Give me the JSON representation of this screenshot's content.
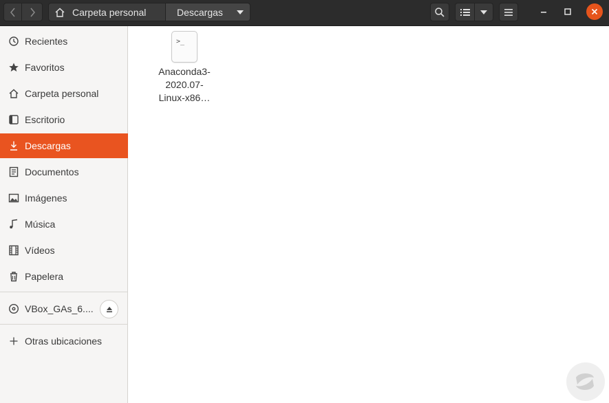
{
  "header": {
    "breadcrumbs": [
      {
        "label": "Carpeta personal",
        "icon": "home-icon"
      },
      {
        "label": "Descargas",
        "icon": "chevron-down-icon"
      }
    ],
    "buttons": {
      "back": "chevron-left-icon",
      "forward": "chevron-right-icon",
      "search": "search-icon",
      "view": "list-view-icon",
      "view_options": "chevron-down-icon",
      "menu": "hamburger-menu-icon",
      "minimize": "minimize-icon",
      "maximize": "maximize-icon",
      "close": "close-icon"
    }
  },
  "sidebar": {
    "items": [
      {
        "label": "Recientes",
        "icon": "clock-icon"
      },
      {
        "label": "Favoritos",
        "icon": "star-icon"
      },
      {
        "label": "Carpeta personal",
        "icon": "home-icon"
      },
      {
        "label": "Escritorio",
        "icon": "desktop-icon"
      },
      {
        "label": "Descargas",
        "icon": "download-icon",
        "active": true
      },
      {
        "label": "Documentos",
        "icon": "document-icon"
      },
      {
        "label": "Imágenes",
        "icon": "image-icon"
      },
      {
        "label": "Música",
        "icon": "music-icon"
      },
      {
        "label": "Vídeos",
        "icon": "video-icon"
      },
      {
        "label": "Papelera",
        "icon": "trash-icon"
      }
    ],
    "devices": [
      {
        "label": "VBox_GAs_6....",
        "icon": "disc-icon",
        "action": "eject-icon"
      }
    ],
    "other": {
      "label": "Otras ubicaciones",
      "icon": "plus-icon"
    }
  },
  "main": {
    "files": [
      {
        "name": "Anaconda3-\n2020.07-\nLinux-x86…",
        "lines": [
          "Anaconda3-",
          "2020.07-",
          "Linux-x86…"
        ],
        "icon": "script-file-icon",
        "icon_text": ">_"
      }
    ]
  },
  "colors": {
    "accent": "#e95420",
    "headerbar": "#2c2c2c",
    "sidebar_bg": "#f6f5f4"
  }
}
